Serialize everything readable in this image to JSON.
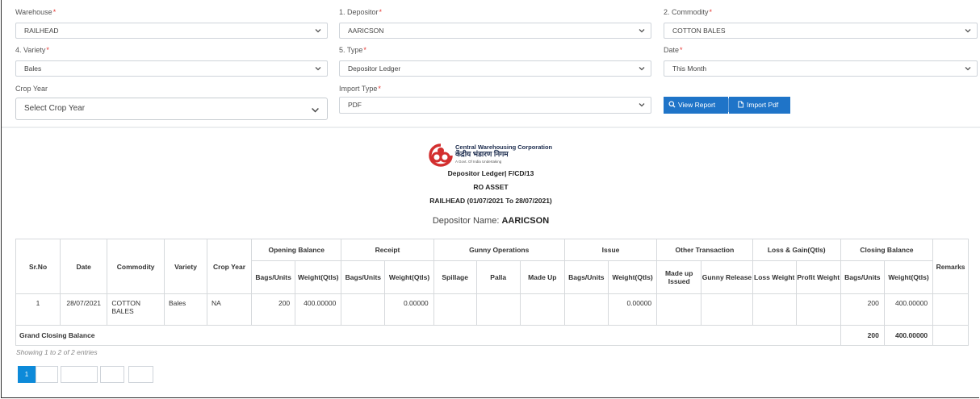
{
  "filters": {
    "warehouse": {
      "label": "Warehouse",
      "value": "RAILHEAD"
    },
    "depositor": {
      "label": "1. Depositor",
      "value": "AARICSON"
    },
    "commodity": {
      "label": "2. Commodity",
      "value": "COTTON BALES"
    },
    "variety": {
      "label": "4. Variety",
      "value": "Bales"
    },
    "type": {
      "label": "5. Type",
      "value": "Depositor Ledger"
    },
    "date": {
      "label": "Date",
      "value": "This Month"
    },
    "crop_year": {
      "label": "Crop Year",
      "value": "Select Crop Year"
    },
    "import_type": {
      "label": "Import Type",
      "value": "PDF"
    },
    "required_marker": "*"
  },
  "buttons": {
    "view_report": "View Report",
    "import_pdf": "Import Pdf"
  },
  "report": {
    "org_name_en": "Central Warehousing Corporation",
    "org_name_hi": "केंद्रीय भंडारण निगम",
    "org_tagline": "A Govt. Of India Undertaking",
    "form_title": "Depositor Ledger| F/CD/13",
    "office": "RO ASSET",
    "period": "RAILHEAD (01/07/2021 To 28/07/2021)",
    "depositor_label": "Depositor Name:",
    "depositor_value": "AARICSON"
  },
  "table": {
    "group_headers": {
      "opening": "Opening Balance",
      "receipt": "Receipt",
      "gunny": "Gunny Operations",
      "issue": "Issue",
      "other": "Other Transaction",
      "loss_gain": "Loss & Gain(Qtls)",
      "closing": "Closing Balance"
    },
    "columns": {
      "srno": "Sr.No",
      "date": "Date",
      "commodity": "Commodity",
      "variety": "Variety",
      "crop_year": "Crop Year",
      "bags_units": "Bags/Units",
      "weight_qtls": "Weight(Qtls)",
      "spillage": "Spillage",
      "palla": "Palla",
      "made_up": "Made Up",
      "made_up_issued": "Made up Issued",
      "gunny_release": "Gunny Release",
      "loss_weight": "Loss Weight",
      "profit_weight": "Profit Weight",
      "remarks": "Remarks"
    },
    "row": {
      "srno": "1",
      "date": "28/07/2021",
      "commodity": "COTTON BALES",
      "variety": "Bales",
      "crop_year": "NA",
      "opening_bags": "200",
      "opening_weight": "400.00000",
      "receipt_weight": "0.00000",
      "issue_weight": "0.00000",
      "closing_bags": "200",
      "closing_weight": "400.00000"
    },
    "grand": {
      "label": "Grand Closing Balance",
      "bags": "200",
      "weight": "400.00000"
    }
  },
  "pagination": {
    "info": "Showing 1 to 2 of 2 entries",
    "current_page": "1"
  },
  "colors": {
    "accent": "#1f74c8",
    "pager_active": "#0d8ad9",
    "logo_red": "#d32f2f"
  }
}
